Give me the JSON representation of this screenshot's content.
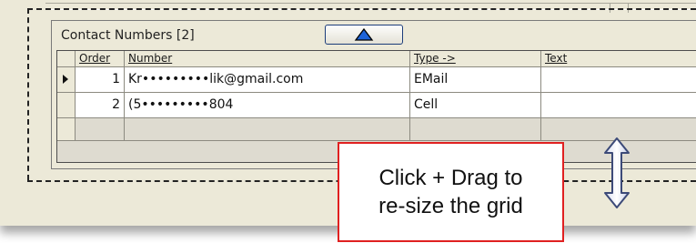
{
  "panel": {
    "title": "Contact Numbers  [2]",
    "collapse_icon": "triangle-up-icon",
    "accent_color": "#1c3d7a"
  },
  "grid": {
    "columns": [
      "Order",
      "Number",
      "Type ->",
      "Text"
    ],
    "rows": [
      {
        "order": "1",
        "number": "Kr•••••••••lik@gmail.com",
        "type": "EMail",
        "text": "",
        "current": true
      },
      {
        "order": "2",
        "number": "(5•••••••••804",
        "type": "Cell",
        "text": "",
        "current": false
      }
    ],
    "current_row_icon": "row-pointer-icon"
  },
  "callout": {
    "line1": "Click + Drag to",
    "line2": "re-size the grid",
    "border_color": "#e02020"
  },
  "resize_handle_icon": "vertical-resize-arrow-icon"
}
